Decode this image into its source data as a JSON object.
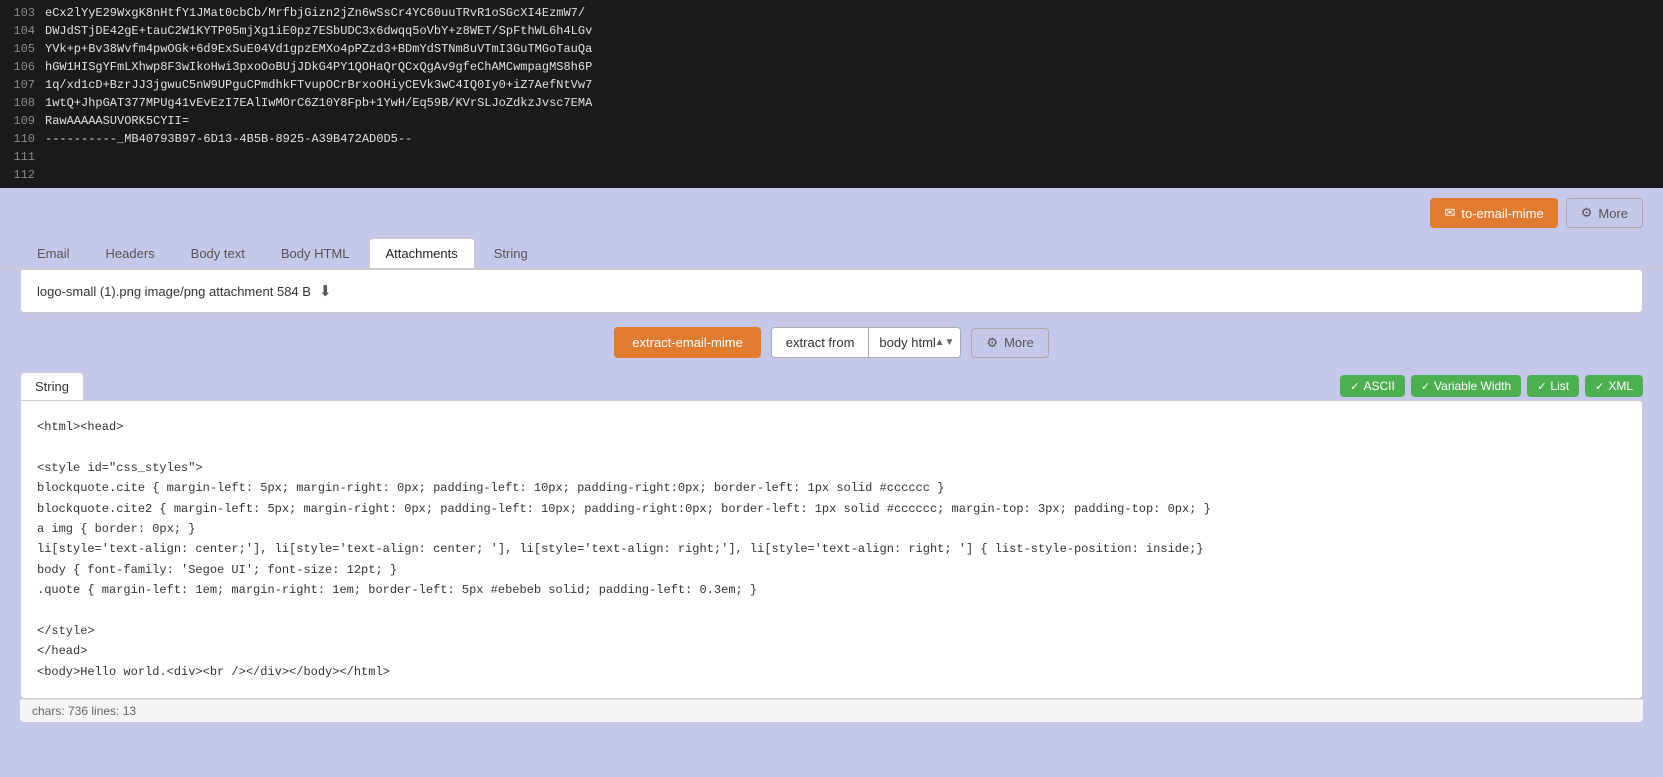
{
  "code_top": {
    "lines": [
      {
        "number": "103",
        "content": "eCx2lYyE29WxgK8nHtfY1JMat0cbCb/MrfbjGizn2jZn6wSsCr4YC60uuTRvR1oSGcXI4EzmW7/"
      },
      {
        "number": "104",
        "content": "DWJdSTjDE42gE+tauC2W1KYTP05mjXg1iE0pz7ESbUDC3x6dwqq5oVbY+z8WET/SpFthWL6h4LGv"
      },
      {
        "number": "105",
        "content": "YVk+p+Bv38Wvfm4pwOGk+6d9ExSuE04Vd1gpzEMXo4pPZzd3+BDmYdSTNm8uVTmI3GuTMGoTauQa"
      },
      {
        "number": "106",
        "content": "hGW1HISgYFmLXhwp8F3wIkoHwi3pxoOoBUjJDkG4PY1QOHaQrQCxQgAv9gfeChAMCwmpagMS8h6P"
      },
      {
        "number": "107",
        "content": "1q/xd1cD+BzrJJ3jgwuC5nW9UPguCPmdhkFTvupOCrBrxoOHiyCEVk3wC4IQ0Iy0+iZ7AefNtVw7"
      },
      {
        "number": "108",
        "content": "1wtQ+JhpGAT377MPUg41vEvEzI7EAlIwMOrC6Z10Y8Fpb+1YwH/Eq59B/KVrSLJoZdkzJvsc7EMA"
      },
      {
        "number": "109",
        "content": "RawAAAAASUVORK5CYII="
      },
      {
        "number": "110",
        "content": "----------_MB40793B97-6D13-4B5B-8925-A39B472AD0D5--"
      },
      {
        "number": "111",
        "content": ""
      },
      {
        "number": "112",
        "content": ""
      }
    ]
  },
  "toolbar_top": {
    "email_mime_label": "to-email-mime",
    "more_label": "More"
  },
  "tabs": [
    {
      "id": "email",
      "label": "Email"
    },
    {
      "id": "headers",
      "label": "Headers"
    },
    {
      "id": "body-text",
      "label": "Body text"
    },
    {
      "id": "body-html",
      "label": "Body HTML"
    },
    {
      "id": "attachments",
      "label": "Attachments",
      "active": true
    },
    {
      "id": "string",
      "label": "String"
    }
  ],
  "attachment": {
    "filename": "logo-small (1).png",
    "mimetype": "image/png",
    "type": "attachment",
    "size": "584 B"
  },
  "toolbar_mid": {
    "extract_label": "extract-email-mime",
    "extract_from_label": "extract from",
    "extract_from_value": "body html",
    "more_label": "More"
  },
  "string_section": {
    "tab_label": "String",
    "options": [
      {
        "id": "ascii",
        "label": "ASCII"
      },
      {
        "id": "variable-width",
        "label": "Variable Width"
      },
      {
        "id": "list",
        "label": "List"
      },
      {
        "id": "xml",
        "label": "XML"
      }
    ],
    "code": "<html><head>\n\n<style id=\"css_styles\">\nblockquote.cite { margin-left: 5px; margin-right: 0px; padding-left: 10px; padding-right:0px; border-left: 1px solid #cccccc }\nblockquote.cite2 { margin-left: 5px; margin-right: 0px; padding-left: 10px; padding-right:0px; border-left: 1px solid #cccccc; margin-top: 3px; padding-top: 0px; }\na img { border: 0px; }\nli[style='text-align: center;'], li[style='text-align: center; '], li[style='text-align: right;'], li[style='text-align: right; '] { list-style-position: inside;}\nbody { font-family: 'Segoe UI'; font-size: 12pt; }\n.quote { margin-left: 1em; margin-right: 1em; border-left: 5px #ebebeb solid; padding-left: 0.3em; }\n\n</style>\n</head>\n<body>Hello world.<div><br /></div></body></html>",
    "footer": "chars: 736  lines: 13"
  }
}
